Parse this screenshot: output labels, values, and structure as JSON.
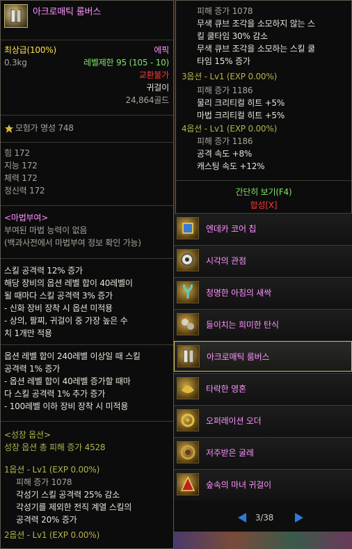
{
  "tooltip": {
    "title": "아크로매틱 룸버스",
    "grade": "최상급(100%)",
    "rarity": "에픽",
    "weight": "0.3kg",
    "level_limit": "레벨제한 95 (105 - 10)",
    "trade": "교환불가",
    "slot": "귀걸이",
    "price": "24,864골드",
    "fame": "모험가 명성 748",
    "stats": [
      "힘 172",
      "지능 172",
      "체력 172",
      "정신력 172"
    ],
    "enchant_header": "<마법부여>",
    "enchant_lines": [
      "부여된 마법 능력이 없음",
      "(백과사전에서 마법부여 정보 확인 가능)"
    ],
    "option_block1": [
      "스킬 공격력 12% 증가",
      "해당 장비의 옵션 레벨 합이 40레벨이",
      "될 때마다 스킬 공격력 3% 증가",
      "- 신화 장비 장착 시 옵션 미적용",
      "- 상의, 팔찌, 귀걸이 중 가장 높은 수",
      "치 1개만 적용"
    ],
    "option_block2": [
      "옵션 레벨 합이 240레벨 이상일 때 스킬",
      "공격력 1% 증가",
      "- 옵션 레벨 합이 40레벨 증가할 때마",
      "다 스킬 공격력 1% 추가 증가",
      "- 100레벨 이하 장비 장착 시 미적용"
    ],
    "growth_header": "<성장 옵션>",
    "growth_total": "성장 옵션 총 피해 증가 4528",
    "option1_header": "1옵션 - Lv1 (EXP 0.00%)",
    "option1_lines": [
      "피해 증가 1078",
      "각성기 스킬 공격력 25% 감소",
      "각성기를 제외한 전직 계열 스킬의",
      "공격력 20% 증가"
    ],
    "option2_header": "2옵션 - Lv1 (EXP 0.00%)"
  },
  "tooltip_right": {
    "option2_lines": [
      "피해 증가 1078",
      "무색 큐브 조각을 소모하지 않는 스",
      "킬 쿨타임 30% 감소",
      "무색 큐브 조각을 소모하는 스킬 쿨",
      "타임 15% 증가"
    ],
    "option3_header": "3옵션 - Lv1 (EXP 0.00%)",
    "option3_lines": [
      "피해 증가 1186",
      "물리 크리티컬 히트 +5%",
      "마법 크리티컬 히트 +5%"
    ],
    "option4_header": "4옵션 - Lv1 (EXP 0.00%)",
    "option4_lines": [
      "피해 증가 1186",
      "공격 속도 +8%",
      "캐스팅 속도 +12%"
    ],
    "brief_view": "간단히 보기(F4)",
    "synergy": "합성[X]"
  },
  "item_list": {
    "items": [
      {
        "name": "엔데카 코어 칩",
        "icon": "core-chip-icon"
      },
      {
        "name": "시각의 관점",
        "icon": "eye-lens-icon"
      },
      {
        "name": "청명한 아침의 새싹",
        "icon": "sprout-icon"
      },
      {
        "name": "들이치는 희미한 탄식",
        "icon": "sigh-icon"
      },
      {
        "name": "아크로매틱 룸버스",
        "icon": "rhombus-icon",
        "selected": true
      },
      {
        "name": "타락한 영혼",
        "icon": "soul-icon"
      },
      {
        "name": "오퍼레이션 오더",
        "icon": "order-icon"
      },
      {
        "name": "저주받은 굴레",
        "icon": "chain-icon"
      },
      {
        "name": "숲속의 마녀 귀걸이",
        "icon": "witch-earring-icon"
      }
    ],
    "page": "3/38"
  }
}
